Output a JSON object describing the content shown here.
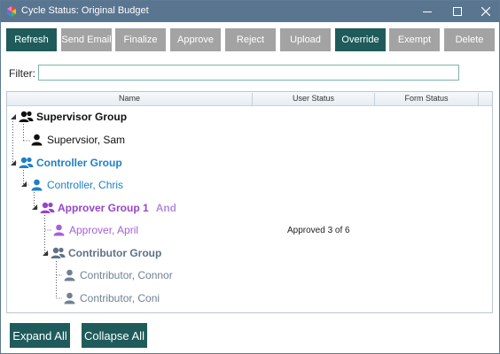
{
  "window": {
    "title": "Cycle Status: Original Budget"
  },
  "toolbar": {
    "buttons": [
      {
        "label": "Refresh",
        "state": "active"
      },
      {
        "label": "Send Email",
        "state": "disabled"
      },
      {
        "label": "Finalize",
        "state": "disabled"
      },
      {
        "label": "Approve",
        "state": "disabled"
      },
      {
        "label": "Reject",
        "state": "disabled"
      },
      {
        "label": "Upload",
        "state": "disabled"
      },
      {
        "label": "Override",
        "state": "active"
      },
      {
        "label": "Exempt",
        "state": "disabled"
      },
      {
        "label": "Delete",
        "state": "disabled"
      }
    ]
  },
  "filter": {
    "label": "Filter:",
    "value": ""
  },
  "grid": {
    "columns": [
      "Name",
      "User Status",
      "Form Status"
    ],
    "rows": [
      {
        "name": "Supervisor Group",
        "type": "group",
        "color": "#111111",
        "user_status": ""
      },
      {
        "name": "Supervsior, Sam",
        "type": "user",
        "color": "#111111",
        "user_status": ""
      },
      {
        "name": "Controller Group",
        "type": "group",
        "color": "#1e7fc8",
        "user_status": ""
      },
      {
        "name": "Controller, Chris",
        "type": "user",
        "color": "#1e7fc8",
        "user_status": ""
      },
      {
        "name": "Approver Group 1",
        "type": "group",
        "color": "#9546c9",
        "conjunction": "And",
        "conjunction_color": "#b58ee0",
        "user_status": ""
      },
      {
        "name": "Approver, April",
        "type": "user",
        "color": "#a55fdb",
        "user_status": "Approved 3 of 6"
      },
      {
        "name": "Contributor Group",
        "type": "group",
        "color": "#5f7184",
        "user_status": ""
      },
      {
        "name": "Contributor, Connor",
        "type": "user",
        "color": "#6f8193",
        "user_status": ""
      },
      {
        "name": "Contributor, Coni",
        "type": "user",
        "color": "#6f8193",
        "user_status": ""
      }
    ]
  },
  "footer": {
    "expand_all": "Expand All",
    "collapse_all": "Collapse All"
  },
  "colors": {
    "titlebar": "#5a7590",
    "button_active": "#1f5b5b",
    "button_disabled": "#a3a3a3"
  },
  "icons": {
    "app": "colorful-pinwheel-icon",
    "group": "users-group-icon",
    "user": "user-icon",
    "expander": "expanded-triangle-icon"
  }
}
